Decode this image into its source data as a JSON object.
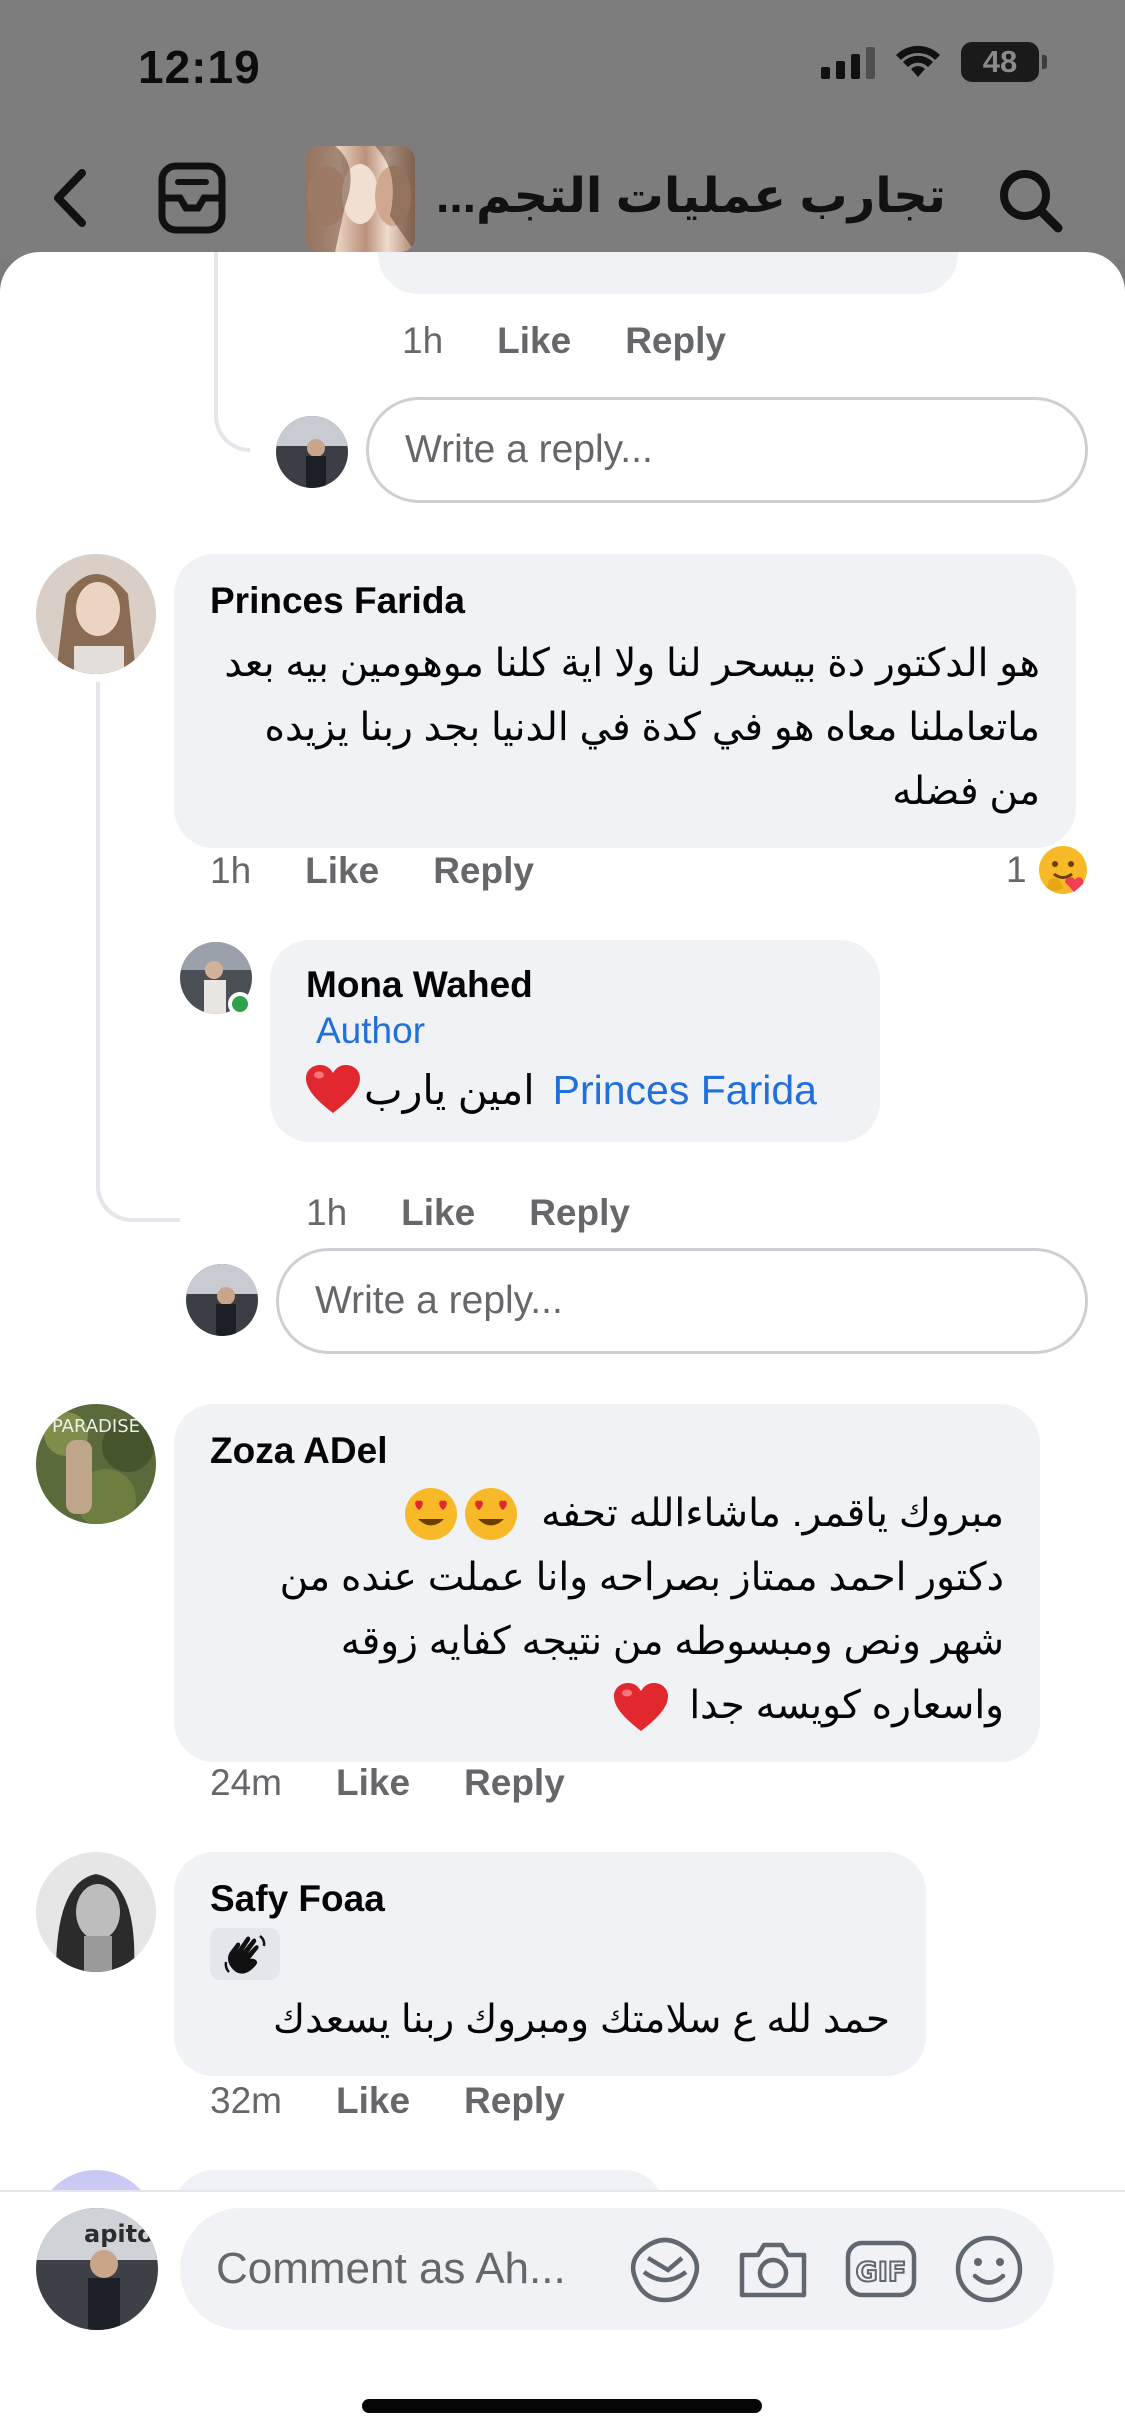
{
  "status_bar": {
    "time": "12:19",
    "battery": "48"
  },
  "header": {
    "group_title": "تجارب عمليات التجم...",
    "icons": [
      "back-chevron-icon",
      "inbox-icon",
      "search-icon"
    ]
  },
  "thread": {
    "top_reply_actions": {
      "time": "1h",
      "like": "Like",
      "reply": "Reply"
    },
    "reply_placeholder": "Write a reply..."
  },
  "comments": [
    {
      "name": "Princes Farida",
      "text": "هو الدكتور دة بيسحر لنا ولا اية كلنا موهومين بيه بعد ماتعاملنا معاه هو في كدة في الدنيا بجد ربنا يزيده من فضله",
      "time": "1h",
      "like": "Like",
      "reply": "Reply",
      "reaction_count": "1",
      "reaction_icon": "hug-emoji",
      "replies": [
        {
          "name": "Mona Wahed",
          "badge": "Author",
          "mention": "Princes Farida",
          "text": "امين يارب",
          "emoji": "red-heart",
          "time": "1h",
          "like": "Like",
          "reply": "Reply"
        }
      ],
      "reply_placeholder": "Write a reply..."
    },
    {
      "name": "Zoza ADel",
      "line1": "مبروك ياقمر. ماشاءالله تحفه",
      "line1_emoji": "heart-eyes",
      "text": "دكتور احمد ممتاز بصراحه وانا عملت عنده من شهر ونص ومبسوطه من نتيجه كفايه زوقه واسعاره كويسه جدا",
      "end_emoji": "red-heart",
      "time": "24m",
      "like": "Like",
      "reply": "Reply"
    },
    {
      "name": "Safy Foaa",
      "sticker": "waving-hand",
      "text": "حمد لله ع سلامتك ومبروك ربنا يسعدك",
      "time": "32m",
      "like": "Like",
      "reply": "Reply"
    }
  ],
  "composer": {
    "placeholder": "Comment as Ah...",
    "gif_label": "GIF",
    "icons": [
      "avatar-sticker-icon",
      "camera-icon",
      "gif-icon",
      "emoji-icon"
    ]
  },
  "colors": {
    "link_blue": "#216fdb",
    "bubble_bg": "#f0f2f5",
    "secondary_text": "#65676b",
    "online_green": "#31a24c"
  }
}
